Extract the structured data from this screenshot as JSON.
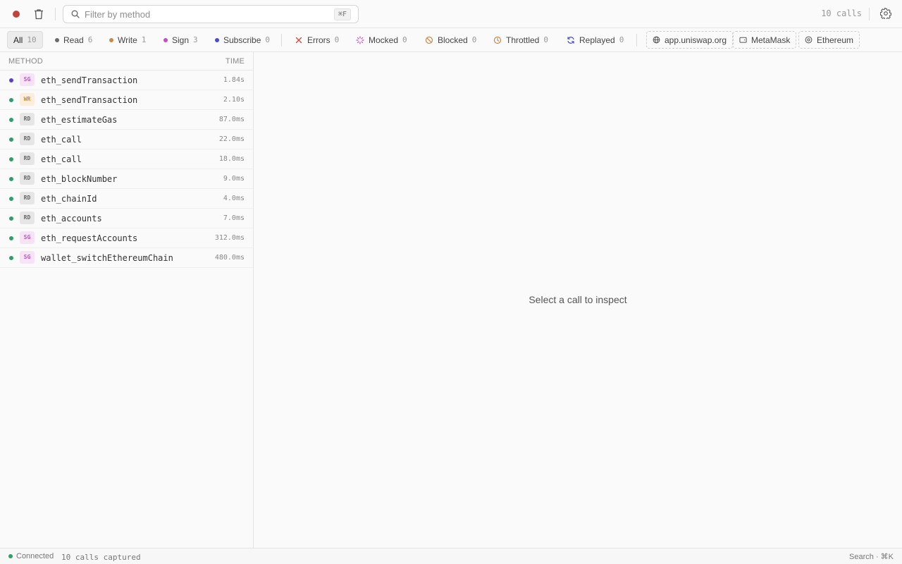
{
  "toolbar": {
    "record_icon": "record-dot-icon",
    "clear_icon": "trash-icon",
    "search": {
      "placeholder": "Filter by method",
      "value": "",
      "shortcut": "⌘F"
    },
    "call_count": "10 calls",
    "settings_icon": "gear-icon"
  },
  "filters": [
    {
      "label": "All",
      "count": "10",
      "active": true
    },
    {
      "label": "Read",
      "count": "6",
      "dot_color": "#6b6b6b"
    },
    {
      "label": "Write",
      "count": "1",
      "dot_color": "#c8894a"
    },
    {
      "label": "Sign",
      "count": "3",
      "dot_color": "#c44ec4"
    },
    {
      "label": "Subscribe",
      "count": "0",
      "dot_color": "#4a4ad0"
    },
    {
      "label": "Errors",
      "count": "0",
      "icon": "x-icon",
      "color": "#d04a3a"
    },
    {
      "label": "Mocked",
      "count": "0",
      "icon": "spinner-icon",
      "color": "#c44ec4"
    },
    {
      "label": "Blocked",
      "count": "0",
      "icon": "blocked-icon",
      "color": "#c8894a"
    },
    {
      "label": "Throttled",
      "count": "0",
      "icon": "clock-icon",
      "color": "#c8894a"
    },
    {
      "label": "Replayed",
      "count": "0",
      "icon": "replay-icon",
      "color": "#4a4ad0"
    }
  ],
  "context": {
    "origin": "app.uniswap.org",
    "wallet": "MetaMask",
    "network": "Ethereum"
  },
  "list": {
    "header_method": "METHOD",
    "header_time": "TIME",
    "rows": [
      {
        "status_color": "#5a3fd0",
        "badge": "SG",
        "method": "eth_sendTransaction",
        "time": "1.84s"
      },
      {
        "status_color": "#2e9e6a",
        "badge": "WR",
        "method": "eth_sendTransaction",
        "time": "2.10s"
      },
      {
        "status_color": "#2e9e6a",
        "badge": "RD",
        "method": "eth_estimateGas",
        "time": "87.0ms"
      },
      {
        "status_color": "#2e9e6a",
        "badge": "RD",
        "method": "eth_call",
        "time": "22.0ms"
      },
      {
        "status_color": "#2e9e6a",
        "badge": "RD",
        "method": "eth_call",
        "time": "18.0ms"
      },
      {
        "status_color": "#2e9e6a",
        "badge": "RD",
        "method": "eth_blockNumber",
        "time": "9.0ms"
      },
      {
        "status_color": "#2e9e6a",
        "badge": "RD",
        "method": "eth_chainId",
        "time": "4.0ms"
      },
      {
        "status_color": "#2e9e6a",
        "badge": "RD",
        "method": "eth_accounts",
        "time": "7.0ms"
      },
      {
        "status_color": "#2e9e6a",
        "badge": "SG",
        "method": "eth_requestAccounts",
        "time": "312.0ms"
      },
      {
        "status_color": "#2e9e6a",
        "badge": "SG",
        "method": "wallet_switchEthereumChain",
        "time": "480.0ms"
      }
    ]
  },
  "detail": {
    "empty_text": "Select a call to inspect"
  },
  "status": {
    "connected_color": "#2e9e6a",
    "connected_label": "Connected",
    "captured": "10 calls captured",
    "hint": "Search · ⌘K"
  },
  "colors": {
    "record": "#c0443b",
    "badge_sg_bg": "#f6e3f6",
    "badge_sg_fg": "#c44ec4",
    "badge_wr_bg": "#fbeedd",
    "badge_wr_fg": "#c8894a",
    "badge_rd_bg": "#e6e6e6",
    "badge_rd_fg": "#666666"
  }
}
